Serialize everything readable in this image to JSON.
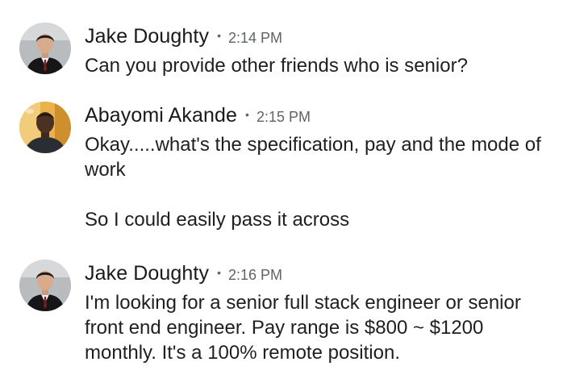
{
  "messages": [
    {
      "sender": "Jake Doughty",
      "separator": "•",
      "time": "2:14 PM",
      "avatar_icon": "person-avatar-icon",
      "paragraphs": [
        "Can you provide other friends who is senior?"
      ]
    },
    {
      "sender": "Abayomi Akande",
      "separator": "•",
      "time": "2:15 PM",
      "avatar_icon": "person-avatar-icon",
      "paragraphs": [
        "Okay.....what's the specification, pay and the mode of work",
        "So I could easily pass it across"
      ]
    },
    {
      "sender": "Jake Doughty",
      "separator": "•",
      "time": "2:16 PM",
      "avatar_icon": "person-avatar-icon",
      "paragraphs": [
        "I'm looking for a senior full stack engineer or senior front end engineer. Pay range is $800 ~ $1200 monthly. It's a 100% remote position."
      ]
    }
  ],
  "colors": {
    "sender": "#1a1a1a",
    "meta": "#5f6368",
    "body_text": "#1f1f1f",
    "background": "#ffffff"
  }
}
